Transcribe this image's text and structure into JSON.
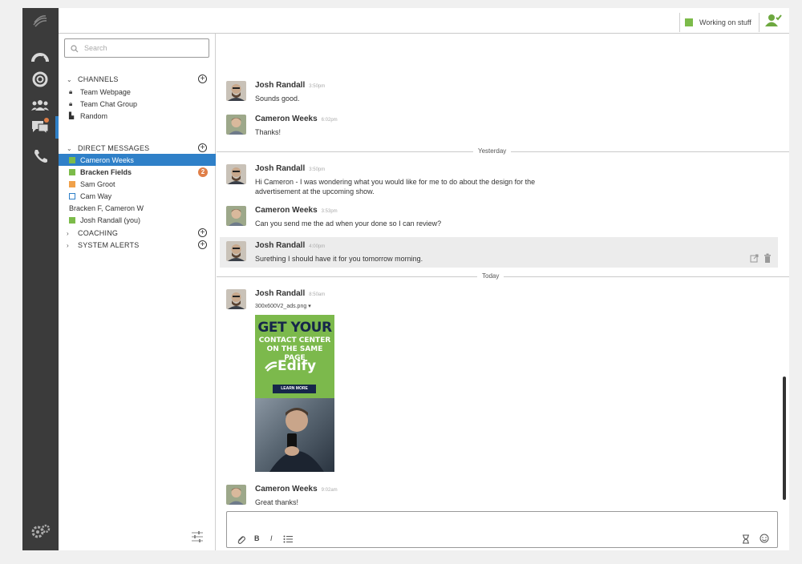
{
  "status": {
    "label": "Working on stuff",
    "color": "#7cbb4a"
  },
  "search": {
    "placeholder": "Search"
  },
  "channels": {
    "title": "CHANNELS",
    "items": [
      {
        "label": "Team Webpage",
        "icon": "lock-icon"
      },
      {
        "label": "Team Chat Group",
        "icon": "lock-icon"
      },
      {
        "label": "Random",
        "icon": "building-icon"
      }
    ]
  },
  "direct_messages": {
    "title": "DIRECT MESSAGES",
    "items": [
      {
        "label": "Cameron Weeks",
        "color": "#7cbb4a",
        "selected": true
      },
      {
        "label": "Bracken Fields",
        "color": "#7cbb4a",
        "bold": true,
        "badge": "2"
      },
      {
        "label": "Sam Groot",
        "color": "#f0a14a"
      },
      {
        "label": "Cam Way",
        "color": "#ffffff"
      },
      {
        "label": "Bracken F, Cameron W"
      },
      {
        "label": "Josh Randall  (you)",
        "color": "#7cbb4a"
      }
    ]
  },
  "coaching": {
    "title": "COACHING"
  },
  "system_alerts": {
    "title": "SYSTEM ALERTS"
  },
  "messages": [
    {
      "name": "Josh Randall",
      "time": "3:50pm",
      "text": "Sounds good."
    },
    {
      "name": "Cameron Weeks",
      "time": "6:02pm",
      "text": "Thanks!"
    },
    {
      "name": "Josh Randall",
      "time": "3:50pm",
      "text": "Hi Cameron - I was wondering what you would like for me to do about the design for the advertisement at the upcoming show."
    },
    {
      "name": "Cameron Weeks",
      "time": "3:53pm",
      "text": "Can you send me the ad when your done so I can review?"
    },
    {
      "name": "Josh Randall",
      "time": "4:00pm",
      "text": "Surething I should have it for you tomorrow morning."
    },
    {
      "name": "Josh Randall",
      "time": "8:50am",
      "text": ""
    },
    {
      "name": "Cameron Weeks",
      "time": "9:02am",
      "text": "Great thanks!"
    }
  ],
  "dividers": {
    "yesterday": "Yesterday",
    "today": "Today"
  },
  "attachment": {
    "filename": "300x600V2_ads.png",
    "headline": "GET YOUR",
    "subline1": "CONTACT CENTER",
    "subline2": "ON THE SAME PAGE",
    "brand": "Edify",
    "cta": "LEARN MORE"
  },
  "composer": {
    "bold": "B",
    "italic": "I"
  }
}
